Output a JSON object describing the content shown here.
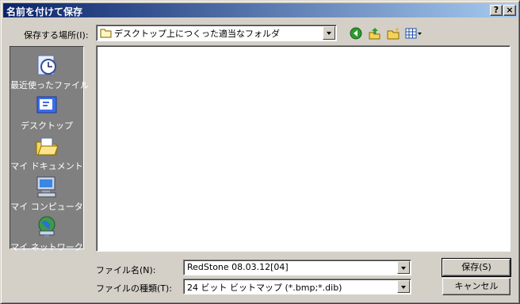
{
  "window": {
    "title": "名前を付けて保存",
    "help_btn": "?",
    "close_btn": "×"
  },
  "save_in": {
    "label": "保存する場所(I):",
    "value": "デスクトップ上につくった適当なフォルダ"
  },
  "toolbar": {
    "icons": [
      "back-icon",
      "up-folder-icon",
      "new-folder-icon",
      "view-menu-icon"
    ]
  },
  "places": [
    {
      "label": "最近使ったファイル",
      "icon": "recent-clock-icon"
    },
    {
      "label": "デスクトップ",
      "icon": "desktop-icon"
    },
    {
      "label": "マイ ドキュメント",
      "icon": "my-documents-icon"
    },
    {
      "label": "マイ コンピュータ",
      "icon": "my-computer-icon"
    },
    {
      "label": "マイ ネットワーク",
      "icon": "my-network-icon"
    }
  ],
  "filename": {
    "label": "ファイル名(N):",
    "value": "RedStone 08.03.12[04]"
  },
  "filetype": {
    "label": "ファイルの種類(T):",
    "value": "24 ビット ビットマップ (*.bmp;*.dib)"
  },
  "buttons": {
    "save": "保存(S)",
    "cancel": "キャンセル"
  },
  "colors": {
    "title_start": "#0a246a",
    "title_end": "#a6caf0",
    "face": "#d4d0c8",
    "places_bg": "#808080"
  }
}
